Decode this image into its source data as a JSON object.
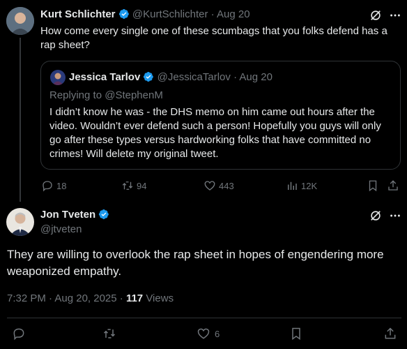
{
  "parent_tweet": {
    "author_name": "Kurt Schlichter",
    "author_handle": "@KurtSchlichter",
    "date": "· Aug 20",
    "text": "How come every single one of these scumbags that you folks defend has a rap sheet?",
    "quote": {
      "author_name": "Jessica Tarlov",
      "author_handle": "@JessicaTarlov",
      "date": "· Aug 20",
      "replying_to": "Replying to @StephenM",
      "text": "I didn’t know he was - the DHS memo on him came out hours after the video. Wouldn’t ever defend such a person! Hopefully you guys will only go after these types versus hardworking folks that have committed no crimes! Will delete my original tweet."
    },
    "metrics": {
      "replies": "18",
      "reposts": "94",
      "likes": "443",
      "views": "12K"
    }
  },
  "main_tweet": {
    "author_name": "Jon Tveten",
    "author_handle": "@jtveten",
    "text": "They are willing to overlook the rap sheet in hopes of engendering more weaponized empathy.",
    "timestamp": "7:32 PM · Aug 20, 2025 · ",
    "views_count": "117",
    "views_label": " Views",
    "likes": "6"
  },
  "colors": {
    "background": "#000000",
    "text": "#e7e9ea",
    "muted": "#71767b",
    "verified": "#1d9bf0",
    "border": "#2f3336"
  },
  "icons": [
    "verified-badge-icon",
    "grok-icon",
    "more-icon",
    "reply-icon",
    "repost-icon",
    "like-icon",
    "views-icon",
    "bookmark-icon",
    "share-icon"
  ]
}
